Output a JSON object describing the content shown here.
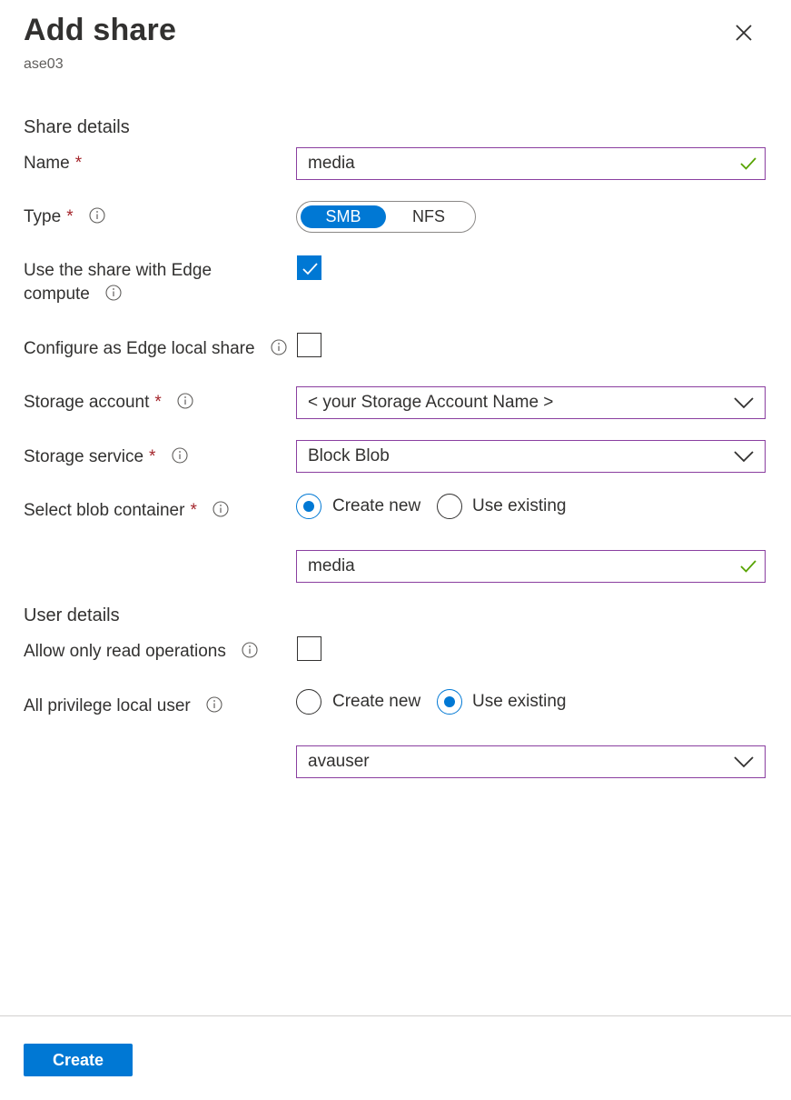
{
  "header": {
    "title": "Add share",
    "subtitle": "ase03"
  },
  "sections": {
    "share_details": "Share details",
    "user_details": "User details"
  },
  "fields": {
    "name": {
      "label": "Name",
      "required": "*",
      "value": "media"
    },
    "type": {
      "label": "Type",
      "required": "*",
      "options": [
        "SMB",
        "NFS"
      ],
      "selected": "SMB"
    },
    "edge_compute": {
      "label_line1": "Use the share with Edge",
      "label_line2": "compute",
      "checked": true
    },
    "edge_local": {
      "label": "Configure as Edge local share",
      "checked": false
    },
    "storage_account": {
      "label": "Storage account",
      "required": "*",
      "value": "< your Storage Account Name >"
    },
    "storage_service": {
      "label": "Storage service",
      "required": "*",
      "value": "Block Blob"
    },
    "blob_container": {
      "label": "Select blob container",
      "required": "*",
      "options": [
        "Create new",
        "Use existing"
      ],
      "selected": "Create new",
      "value": "media"
    },
    "read_only": {
      "label": "Allow only read operations",
      "checked": false
    },
    "local_user": {
      "label": "All privilege local user",
      "options": [
        "Create new",
        "Use existing"
      ],
      "selected": "Use existing",
      "value": "avauser"
    }
  },
  "footer": {
    "create_label": "Create"
  },
  "icons": {
    "close": "close-icon",
    "info": "info-icon",
    "check": "checkmark-icon",
    "chevron": "chevron-down-icon"
  },
  "colors": {
    "accent": "#0078d4",
    "input_border": "#8a3fa0",
    "required": "#a4262c",
    "valid_check": "#57a300"
  }
}
